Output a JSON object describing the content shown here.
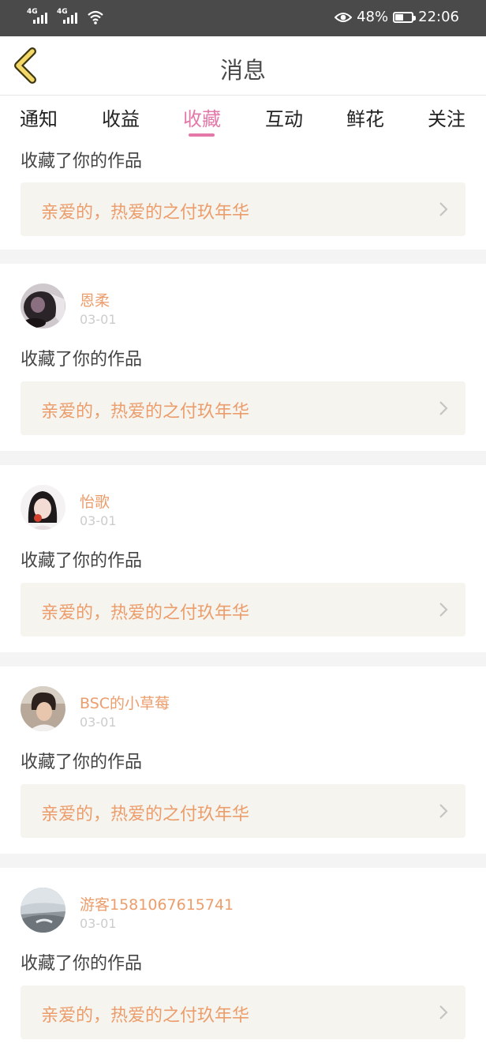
{
  "status_bar": {
    "network_1": "4G",
    "network_2": "4G",
    "battery_percent": "48%",
    "battery_level": 0.48,
    "time": "22:06"
  },
  "header": {
    "title": "消息",
    "back_icon": "back-chevron-icon",
    "accent": "#e478a8",
    "name_color": "#ec9d6c"
  },
  "tabs": [
    {
      "label": "通知",
      "active": false
    },
    {
      "label": "收益",
      "active": false
    },
    {
      "label": "收藏",
      "active": true
    },
    {
      "label": "互动",
      "active": false
    },
    {
      "label": "鲜花",
      "active": false
    },
    {
      "label": "关注",
      "active": false
    }
  ],
  "messages": [
    {
      "name": "",
      "date": "",
      "action": "收藏了你的作品",
      "work": "亲爱的，热爱的之付玖年华"
    },
    {
      "name": "恩柔",
      "date": "03-01",
      "action": "收藏了你的作品",
      "work": "亲爱的，热爱的之付玖年华"
    },
    {
      "name": "怡歌",
      "date": "03-01",
      "action": "收藏了你的作品",
      "work": "亲爱的，热爱的之付玖年华"
    },
    {
      "name": "BSC的小草莓",
      "date": "03-01",
      "action": "收藏了你的作品",
      "work": "亲爱的，热爱的之付玖年华"
    },
    {
      "name": "游客1581067615741",
      "date": "03-01",
      "action": "收藏了你的作品",
      "work": "亲爱的，热爱的之付玖年华"
    }
  ]
}
